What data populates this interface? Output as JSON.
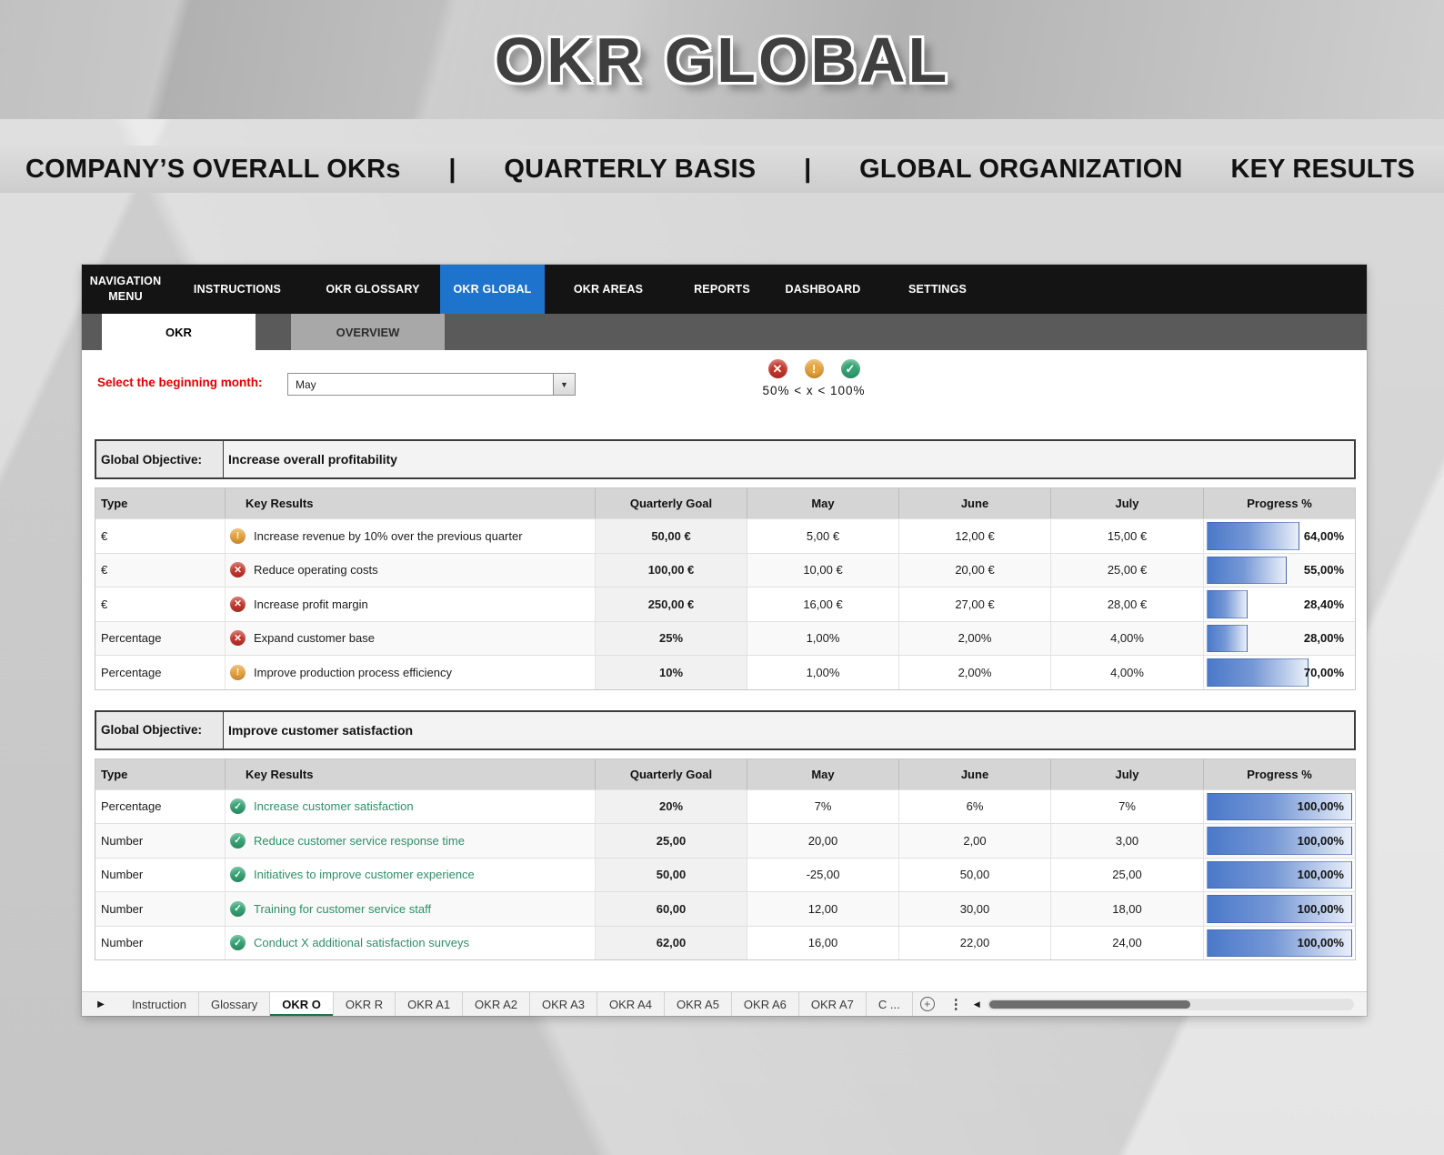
{
  "colors": {
    "accent_blue": "#1e74cc",
    "status_error": "#c5352b",
    "status_warning": "#e7a23c",
    "status_success": "#33a374",
    "key_result_green": "#2f8f68",
    "active_sheet_green": "#217346",
    "progress_bar_blue": "#4472c4"
  },
  "banner": {
    "title": "OKR GLOBAL"
  },
  "subtitle": {
    "part1": "COMPANY’S OVERALL OKRs",
    "sep": "|",
    "part2": "QUARTERLY BASIS",
    "part3": "GLOBAL ORGANIZATION",
    "part4": "KEY RESULTS"
  },
  "nav": {
    "items": [
      {
        "label": "NAVIGATION MENU",
        "active": false
      },
      {
        "label": "INSTRUCTIONS",
        "active": false
      },
      {
        "label": "OKR GLOSSARY",
        "active": false
      },
      {
        "label": "OKR GLOBAL",
        "active": true
      },
      {
        "label": "OKR AREAS",
        "active": false
      },
      {
        "label": "REPORTS",
        "active": false
      },
      {
        "label": "DASHBOARD",
        "active": false
      },
      {
        "label": "SETTINGS",
        "active": false
      }
    ]
  },
  "subtabs": [
    {
      "label": "OKR",
      "active": true
    },
    {
      "label": "OVERVIEW",
      "active": false
    }
  ],
  "controls": {
    "month_label": "Select the beginning month:",
    "month_value": "May",
    "dropdown_arrow": "▼",
    "legend_icons": [
      {
        "name": "error-icon",
        "glyph": "✕",
        "status": "error"
      },
      {
        "name": "warning-icon",
        "glyph": "!",
        "status": "warning"
      },
      {
        "name": "success-icon",
        "glyph": "✓",
        "status": "success"
      }
    ],
    "legend_text": "50%  <  x  <  100%"
  },
  "objective_label": "Global Objective:",
  "table_headers": [
    "Type",
    "Key Results",
    "Quarterly Goal",
    "May",
    "June",
    "July",
    "Progress %"
  ],
  "status_glyphs": {
    "error": "✕",
    "warning": "!",
    "success": "✓"
  },
  "tables": [
    {
      "objective": "Increase overall profitability",
      "rows": [
        {
          "type": "€",
          "status": "warning",
          "key_result": "Increase revenue by 10% over the previous quarter",
          "goal": "50,00 €",
          "may": "5,00 €",
          "june": "12,00 €",
          "july": "15,00 €",
          "progress": "64,00%",
          "progress_value": 64
        },
        {
          "type": "€",
          "status": "error",
          "key_result": "Reduce operating costs",
          "goal": "100,00 €",
          "may": "10,00 €",
          "june": "20,00 €",
          "july": "25,00 €",
          "progress": "55,00%",
          "progress_value": 55
        },
        {
          "type": "€",
          "status": "error",
          "key_result": "Increase profit margin",
          "goal": "250,00 €",
          "may": "16,00 €",
          "june": "27,00 €",
          "july": "28,00 €",
          "progress": "28,40%",
          "progress_value": 28.4
        },
        {
          "type": "Percentage",
          "status": "error",
          "key_result": "Expand customer base",
          "goal": "25%",
          "may": "1,00%",
          "june": "2,00%",
          "july": "4,00%",
          "progress": "28,00%",
          "progress_value": 28
        },
        {
          "type": "Percentage",
          "status": "warning",
          "key_result": "Improve production process efficiency",
          "goal": "10%",
          "may": "1,00%",
          "june": "2,00%",
          "july": "4,00%",
          "progress": "70,00%",
          "progress_value": 70
        }
      ]
    },
    {
      "objective": "Improve customer satisfaction",
      "rows": [
        {
          "type": "Percentage",
          "status": "success",
          "key_result": "Increase customer satisfaction",
          "goal": "20%",
          "may": "7%",
          "june": "6%",
          "july": "7%",
          "progress": "100,00%",
          "progress_value": 100
        },
        {
          "type": "Number",
          "status": "success",
          "key_result": "Reduce customer service response time",
          "goal": "25,00",
          "may": "20,00",
          "june": "2,00",
          "july": "3,00",
          "progress": "100,00%",
          "progress_value": 100
        },
        {
          "type": "Number",
          "status": "success",
          "key_result": "Initiatives to improve customer experience",
          "goal": "50,00",
          "may": "-25,00",
          "june": "50,00",
          "july": "25,00",
          "progress": "100,00%",
          "progress_value": 100
        },
        {
          "type": "Number",
          "status": "success",
          "key_result": "Training for customer service staff",
          "goal": "60,00",
          "may": "12,00",
          "june": "30,00",
          "july": "18,00",
          "progress": "100,00%",
          "progress_value": 100
        },
        {
          "type": "Number",
          "status": "success",
          "key_result": "Conduct X additional satisfaction surveys",
          "goal": "62,00",
          "may": "16,00",
          "june": "22,00",
          "july": "24,00",
          "progress": "100,00%",
          "progress_value": 100
        }
      ]
    }
  ],
  "sheetbar": {
    "nav_arrow": "▶",
    "tabs": [
      {
        "label": "Instruction",
        "active": false
      },
      {
        "label": "Glossary",
        "active": false
      },
      {
        "label": "OKR O",
        "active": true
      },
      {
        "label": "OKR R",
        "active": false
      },
      {
        "label": "OKR A1",
        "active": false
      },
      {
        "label": "OKR A2",
        "active": false
      },
      {
        "label": "OKR A3",
        "active": false
      },
      {
        "label": "OKR A4",
        "active": false
      },
      {
        "label": "OKR A5",
        "active": false
      },
      {
        "label": "OKR A6",
        "active": false
      },
      {
        "label": "OKR A7",
        "active": false
      },
      {
        "label": "C ...",
        "active": false
      }
    ],
    "add_sheet": "+",
    "options_dots": "⋮",
    "scroll_left_arrow": "◀"
  }
}
